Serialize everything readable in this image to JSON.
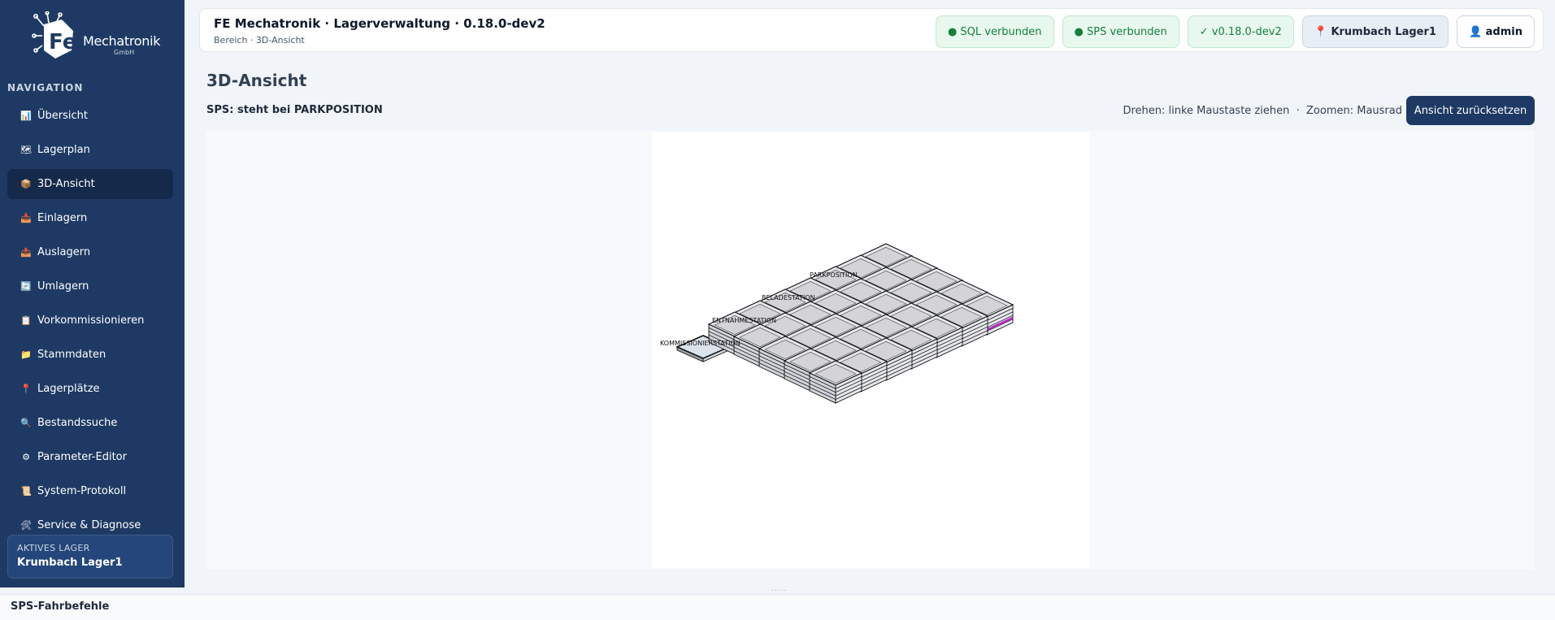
{
  "app": {
    "brand": "Mechatronik",
    "brand_sub": "GmbH"
  },
  "header": {
    "title": "FE Mechatronik · Lagerverwaltung · 0.18.0-dev2",
    "breadcrumb": "Bereich · 3D-Ansicht",
    "chips": {
      "sql": "● SQL verbunden",
      "sps": "● SPS verbunden",
      "version": "✓ v0.18.0-dev2",
      "location": "📍 Krumbach Lager1",
      "user": "👤 admin"
    }
  },
  "sidebar": {
    "heading": "NAVIGATION",
    "items": [
      {
        "label": "Übersicht",
        "icon": "📊",
        "icon_name": "chart-icon"
      },
      {
        "label": "Lagerplan",
        "icon": "🗺",
        "icon_name": "map-icon"
      },
      {
        "label": "3D-Ansicht",
        "icon": "📦",
        "icon_name": "box-icon",
        "active": true
      },
      {
        "label": "Einlagern",
        "icon": "📥",
        "icon_name": "inbox-icon"
      },
      {
        "label": "Auslagern",
        "icon": "📤",
        "icon_name": "outbox-icon"
      },
      {
        "label": "Umlagern",
        "icon": "🔄",
        "icon_name": "refresh-icon"
      },
      {
        "label": "Vorkommissionieren",
        "icon": "📋",
        "icon_name": "clipboard-icon"
      },
      {
        "label": "Stammdaten",
        "icon": "📁",
        "icon_name": "folder-icon"
      },
      {
        "label": "Lagerplätze",
        "icon": "📍",
        "icon_name": "pin-icon"
      },
      {
        "label": "Bestandssuche",
        "icon": "🔍",
        "icon_name": "search-icon"
      },
      {
        "label": "Parameter-Editor",
        "icon": "⚙",
        "icon_name": "gear-icon"
      },
      {
        "label": "System-Protokoll",
        "icon": "📜",
        "icon_name": "scroll-icon"
      },
      {
        "label": "Service & Diagnose",
        "icon": "🛠",
        "icon_name": "tools-icon"
      }
    ],
    "active_lager": {
      "label": "AKTIVES LAGER",
      "value": "Krumbach Lager1"
    }
  },
  "main": {
    "title": "3D-Ansicht",
    "sps_status": "SPS: steht bei PARKPOSITION",
    "hint_rotate": "Drehen: linke Maustaste ziehen",
    "hint_sep": "·",
    "hint_zoom": "Zoomen: Mausrad",
    "reset_button": "Ansicht zurücksetzen",
    "stations": [
      {
        "label": "PARKPOSITION"
      },
      {
        "label": "BELADESTATION"
      },
      {
        "label": "ENTNAHMESTATION"
      },
      {
        "label": "KOMMISSIONIERSTATION"
      }
    ]
  },
  "bottom_panel": {
    "label": "SPS-Fahrbefehle"
  },
  "colors": {
    "sidebar": "#1e3a64",
    "accent": "#1e3a64",
    "ok_text": "#15803d",
    "ok_bg": "#e8f8ee",
    "highlight_tray": "#c026d3"
  }
}
